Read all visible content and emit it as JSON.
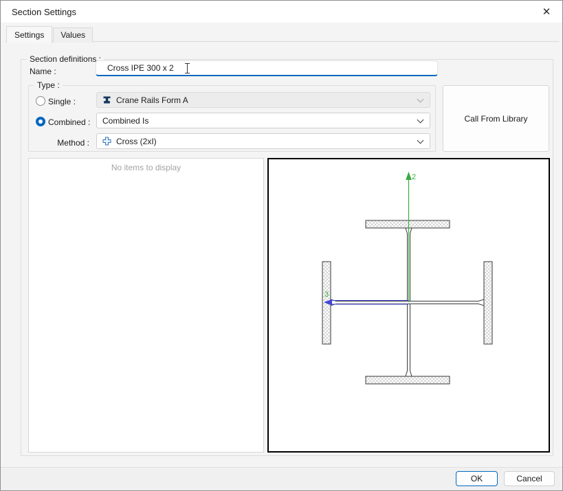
{
  "window": {
    "title": "Section Settings"
  },
  "icons": {
    "close_glyph": "✕",
    "single_combo_icon": "crane-rail-profile",
    "method_combo_icon": "cross-section",
    "dropdown_icon": "chevron-down"
  },
  "tabs": {
    "settings": "Settings",
    "values": "Values"
  },
  "form": {
    "group_label": "Section definitions :",
    "name_label": "Name :",
    "name_value": "Cross IPE 300 x 2",
    "type": {
      "group_label": "Type :",
      "single_label": "Single :",
      "single_value": "Crane Rails Form A",
      "combined_label": "Combined :",
      "combined_value": "Combined Is",
      "method_label": "Method :",
      "method_value": "Cross (2xI)"
    },
    "library_button": "Call From Library"
  },
  "list": {
    "empty_text": "No items to display"
  },
  "preview": {
    "axis_up_label": "2",
    "axis_left_label": "3",
    "axis_up_color": "#3aaa3f",
    "axis_left_color": "#4246d7",
    "label_color": "#3aaa3f",
    "border_color": "#000000"
  },
  "footer": {
    "ok": "OK",
    "cancel": "Cancel"
  },
  "colors": {
    "accent": "#0067c0",
    "selection_blue": "#0067c0"
  }
}
